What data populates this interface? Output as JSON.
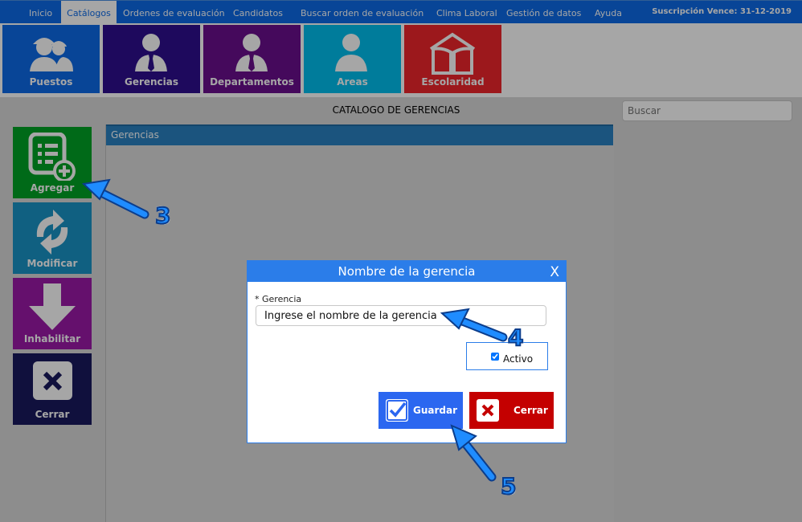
{
  "nav": {
    "items": [
      {
        "label": "Inicio"
      },
      {
        "label": "Catálogos",
        "active": true
      },
      {
        "label": "Ordenes de evaluación"
      },
      {
        "label": "Candidatos"
      },
      {
        "label": "Buscar orden de evaluación"
      },
      {
        "label": "Clima Laboral"
      },
      {
        "label": "Gestión de datos"
      },
      {
        "label": "Ayuda"
      }
    ],
    "subscription": "Suscripción Vence: 31-12-2019"
  },
  "tiles": [
    {
      "label": "Puestos",
      "color": "#0d6be8",
      "icon": "workers-icon"
    },
    {
      "label": "Gerencias",
      "color": "#2e0e8f",
      "icon": "manager-icon"
    },
    {
      "label": "Departamentos",
      "color": "#6a0f8e",
      "icon": "manager-icon"
    },
    {
      "label": "Areas",
      "color": "#00bfef",
      "icon": "person-icon"
    },
    {
      "label": "Escolaridad",
      "color": "#f0262c",
      "icon": "book-icon"
    }
  ],
  "catalog": {
    "title": "CATALOGO DE GERENCIAS",
    "search_placeholder": "Buscar",
    "grid_header": "Gerencias"
  },
  "sidebar": {
    "buttons": [
      {
        "label": "Agregar",
        "color": "#00a325",
        "icon": "add-list-icon"
      },
      {
        "label": "Modificar",
        "color": "#1a94c6",
        "icon": "refresh-icon"
      },
      {
        "label": "Inhabilitar",
        "color": "#9c1aa8",
        "icon": "arrow-down-icon"
      },
      {
        "label": "Cerrar",
        "color": "#1a1a5e",
        "icon": "close-icon"
      }
    ]
  },
  "modal": {
    "title": "Nombre de la gerencia",
    "close": "X",
    "field_label": "* Gerencia",
    "field_value": "Ingrese el nombre de la gerencia",
    "checkbox_label": "Activo",
    "checkbox_checked": true,
    "save_label": "Guardar",
    "cancel_label": "Cerrar"
  },
  "annotations": [
    "3",
    "4",
    "5"
  ]
}
